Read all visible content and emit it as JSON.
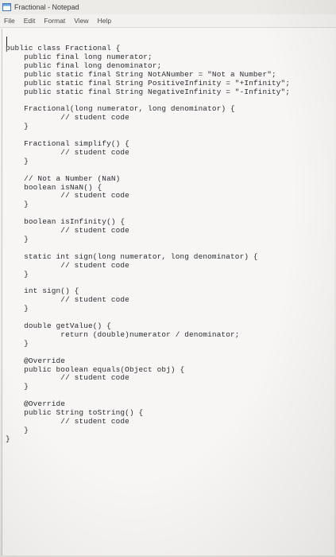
{
  "window": {
    "title": "Fractional - Notepad"
  },
  "menu": [
    "File",
    "Edit",
    "Format",
    "View",
    "Help"
  ],
  "editor": {
    "lines": [
      "public class Fractional {",
      "    public final long numerator;",
      "    public final long denominator;",
      "    public static final String NotANumber = \"Not a Number\";",
      "    public static final String PositiveInfinity = \"+Infinity\";",
      "    public static final String NegativeInfinity = \"-Infinity\";",
      "",
      "    Fractional(long numerator, long denominator) {",
      "            // student code",
      "    }",
      "",
      "    Fractional simplify() {",
      "            // student code",
      "    }",
      "",
      "    // Not a Number (NaN)",
      "    boolean isNaN() {",
      "            // student code",
      "    }",
      "",
      "    boolean isInfinity() {",
      "            // student code",
      "    }",
      "",
      "    static int sign(long numerator, long denominator) {",
      "            // student code",
      "    }",
      "",
      "    int sign() {",
      "            // student code",
      "    }",
      "",
      "    double getValue() {",
      "            return (double)numerator / denominator;",
      "    }",
      "",
      "    @Override",
      "    public boolean equals(Object obj) {",
      "            // student code",
      "    }",
      "",
      "    @Override",
      "    public String toString() {",
      "            // student code",
      "    }",
      "}"
    ]
  }
}
